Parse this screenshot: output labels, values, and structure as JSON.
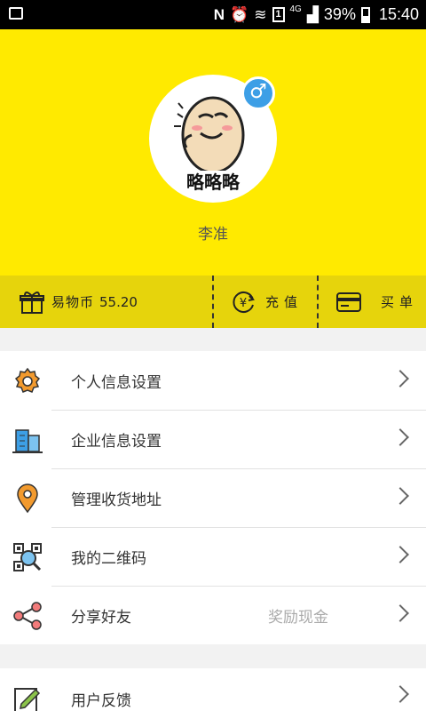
{
  "status_bar": {
    "battery": "39%",
    "time": "15:40",
    "network": "4G",
    "sim": "1"
  },
  "profile": {
    "avatar_caption": "略略略",
    "gender_symbol": "♂",
    "username": "李准"
  },
  "wallet": {
    "coins_label": "易物币",
    "coins_value": "55.20",
    "recharge_label": "充值",
    "recharge_icon": "¥",
    "buy_label": "买单"
  },
  "menu": [
    {
      "label": "个人信息设置",
      "icon": "gear-icon"
    },
    {
      "label": "企业信息设置",
      "icon": "building-icon"
    },
    {
      "label": "管理收货地址",
      "icon": "location-pin-icon"
    },
    {
      "label": "我的二维码",
      "icon": "qr-code-icon"
    },
    {
      "label": "分享好友",
      "icon": "share-icon",
      "extra": "奖励现金"
    }
  ],
  "menu2": [
    {
      "label": "用户反馈",
      "icon": "feedback-icon"
    }
  ],
  "colors": {
    "header": "#ffea00",
    "wallet_bar": "#e6d40c",
    "gender_badge": "#3d9fe6",
    "icon_orange": "#f29a2e"
  }
}
